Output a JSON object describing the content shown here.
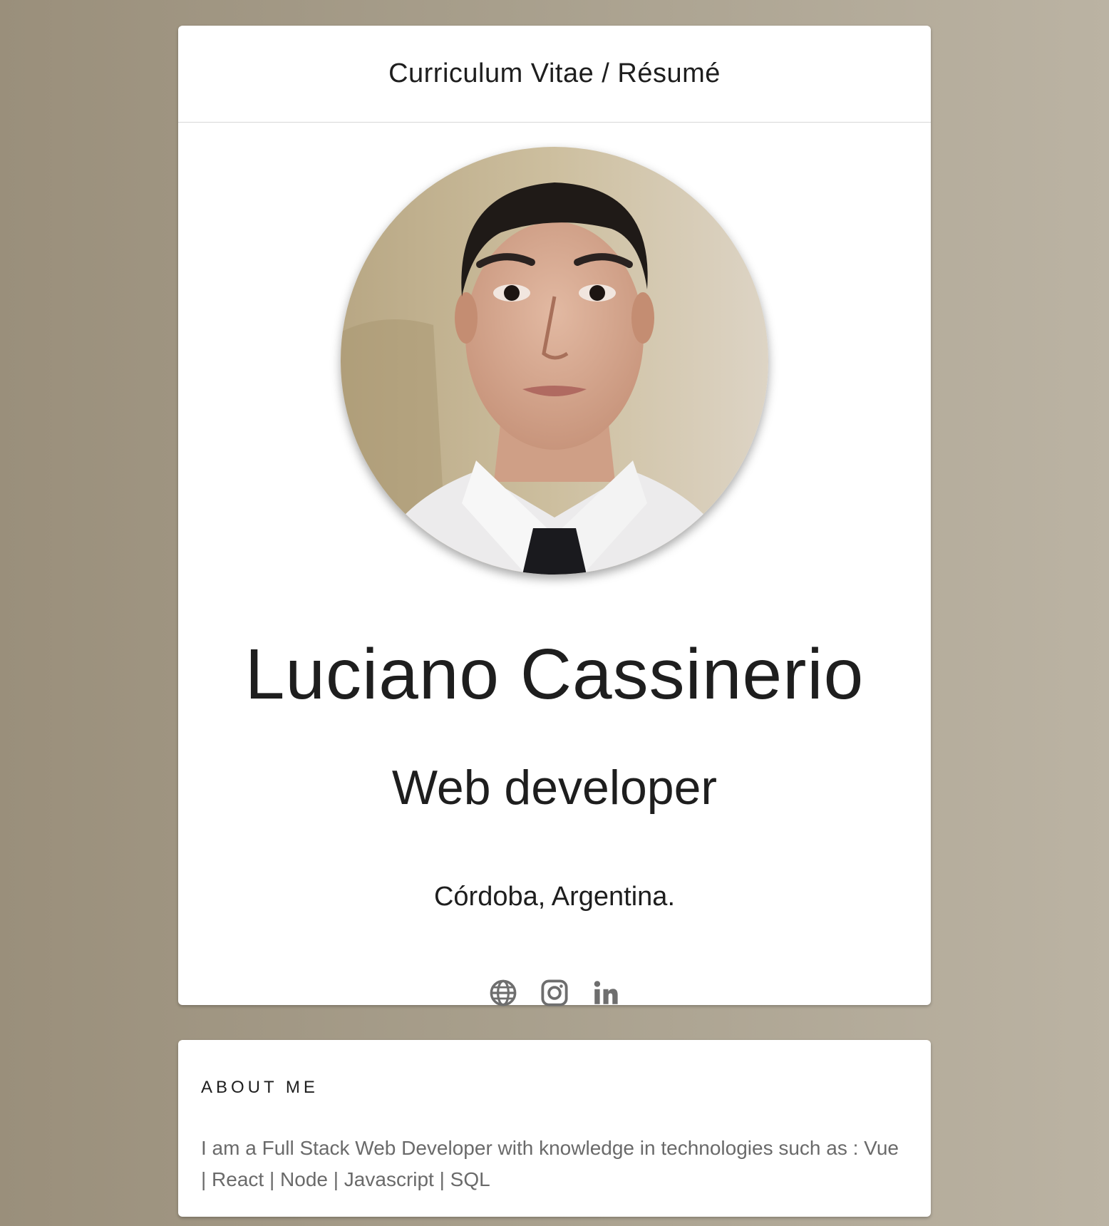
{
  "header": {
    "title": "Curriculum Vitae / Résumé"
  },
  "profile": {
    "name": "Luciano Cassinerio",
    "role": "Web developer",
    "location": "Córdoba, Argentina.",
    "social_links": [
      {
        "icon": "globe-icon"
      },
      {
        "icon": "instagram-icon"
      },
      {
        "icon": "linkedin-icon"
      }
    ]
  },
  "about": {
    "title": "ABOUT ME",
    "text": "I am a Full Stack Web Developer with knowledge in technologies such as : Vue | React | Node | Javascript | SQL"
  },
  "colors": {
    "background_left": "#9a8f7b",
    "background_right": "#bbb3a3",
    "card": "#ffffff",
    "text_primary": "#1e1e1e",
    "text_secondary": "#6a6a6a",
    "icon": "#6e6e6e"
  }
}
